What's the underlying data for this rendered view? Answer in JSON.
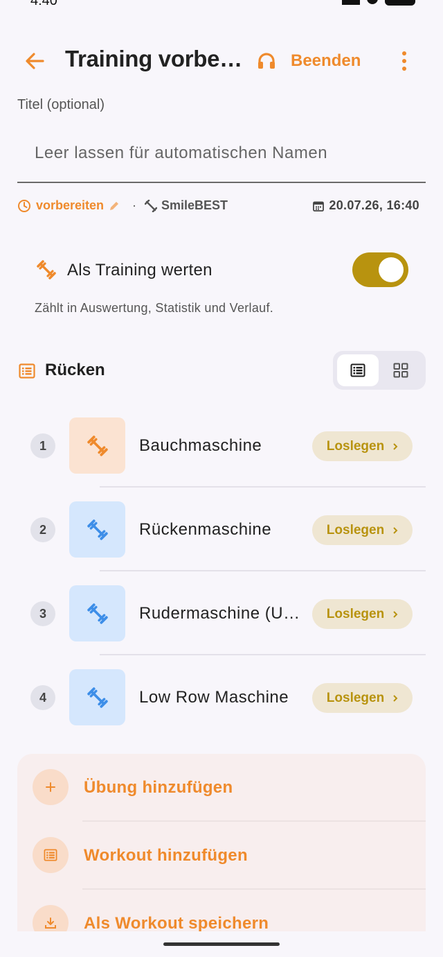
{
  "status_bar": {
    "time": "4:40"
  },
  "app_bar": {
    "title": "Training vorbe…",
    "end_label": "Beenden"
  },
  "title_field": {
    "label": "Titel (optional)",
    "placeholder": "Leer lassen für automatischen Namen",
    "value": ""
  },
  "meta": {
    "state": "vorbereiten",
    "separator": "·",
    "gym": "SmileBEST",
    "datetime": "20.07.26, 16:40"
  },
  "count_toggle": {
    "label": "Als Training werten",
    "hint": "Zählt in Auswertung, Statistik und Verlauf.",
    "on": true
  },
  "section": {
    "title": "Rücken",
    "view_mode": "list"
  },
  "exercises": [
    {
      "number": "1",
      "name": "Bauchmaschine",
      "action": "Loslegen",
      "thumb_color": "orange"
    },
    {
      "number": "2",
      "name": "Rückenmaschine",
      "action": "Loslegen",
      "thumb_color": "blue"
    },
    {
      "number": "3",
      "name": "Rudermaschine (U…",
      "action": "Loslegen",
      "thumb_color": "blue"
    },
    {
      "number": "4",
      "name": "Low Row Maschine",
      "action": "Loslegen",
      "thumb_color": "blue"
    }
  ],
  "actions": [
    {
      "label": "Übung hinzufügen",
      "icon": "plus-icon"
    },
    {
      "label": "Workout hinzufügen",
      "icon": "list-icon"
    },
    {
      "label": "Als Workout speichern",
      "icon": "download-icon"
    }
  ],
  "colors": {
    "accent": "#ef8a2c",
    "gold": "#b8930f",
    "background": "#f8f6fb"
  }
}
